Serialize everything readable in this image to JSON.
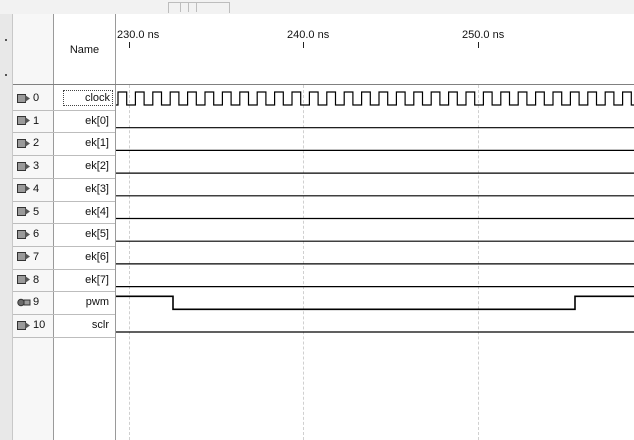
{
  "header": {
    "name_label": "Name"
  },
  "time_axis": {
    "labels": [
      "230.0 ns",
      "240.0 ns",
      "250.0 ns"
    ]
  },
  "signals": [
    {
      "id": "0",
      "name": "clock",
      "kind": "input",
      "waveform": "clock"
    },
    {
      "id": "1",
      "name": "ek[0]",
      "kind": "input",
      "waveform": "low"
    },
    {
      "id": "2",
      "name": "ek[1]",
      "kind": "input",
      "waveform": "low"
    },
    {
      "id": "3",
      "name": "ek[2]",
      "kind": "input",
      "waveform": "low"
    },
    {
      "id": "4",
      "name": "ek[3]",
      "kind": "input",
      "waveform": "low"
    },
    {
      "id": "5",
      "name": "ek[4]",
      "kind": "input",
      "waveform": "low"
    },
    {
      "id": "6",
      "name": "ek[5]",
      "kind": "input",
      "waveform": "low"
    },
    {
      "id": "7",
      "name": "ek[6]",
      "kind": "input",
      "waveform": "low"
    },
    {
      "id": "8",
      "name": "ek[7]",
      "kind": "input",
      "waveform": "low"
    },
    {
      "id": "9",
      "name": "pwm",
      "kind": "output",
      "waveform": "pwm"
    },
    {
      "id": "10",
      "name": "sclr",
      "kind": "input",
      "waveform": "low"
    }
  ],
  "colors": {
    "wave": "#000000",
    "grid": "#d0d0d0",
    "background": "#ffffff"
  }
}
